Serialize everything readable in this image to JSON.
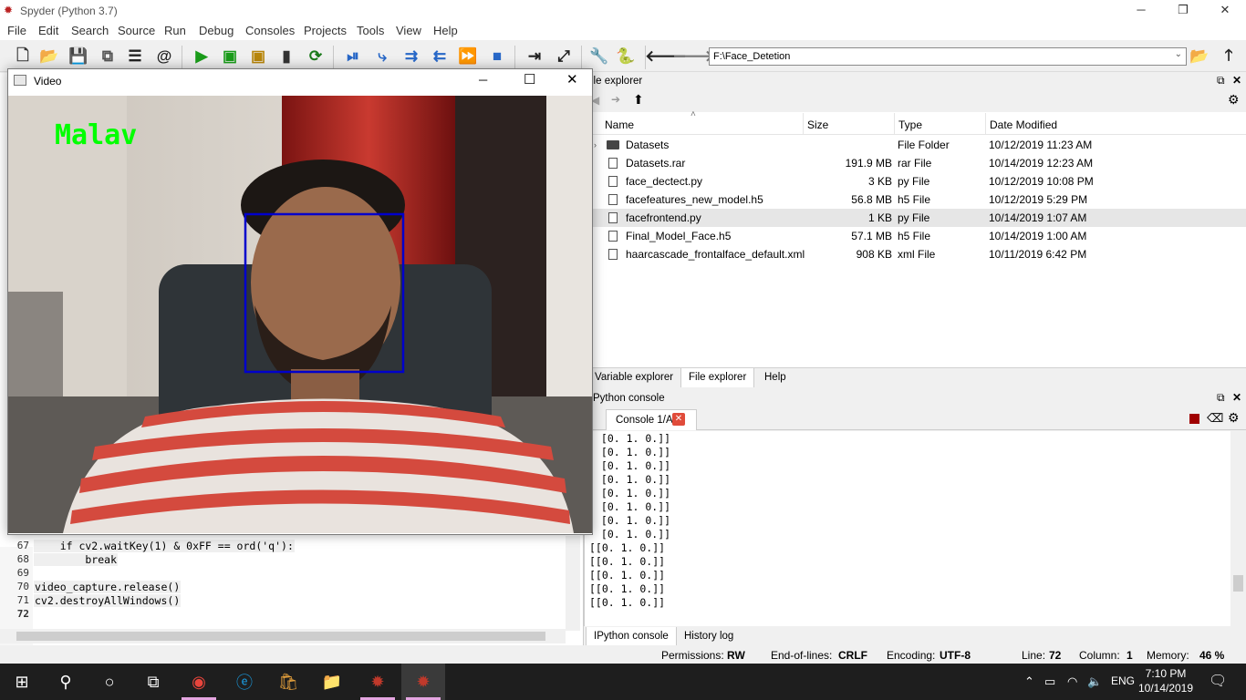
{
  "app": {
    "title": "Spyder (Python 3.7)",
    "minimize": "─",
    "maximize": "❐",
    "close": "✕"
  },
  "menu": [
    "File",
    "Edit",
    "Search",
    "Source",
    "Run",
    "Debug",
    "Consoles",
    "Projects",
    "Tools",
    "View",
    "Help"
  ],
  "toolbar": {
    "path": "F:\\Face_Detetion"
  },
  "editor": {
    "lines": [
      {
        "num": "67",
        "code": "    if cv2.waitKey(1) & 0xFF == ord('q'):"
      },
      {
        "num": "68",
        "code": "        break"
      },
      {
        "num": "69",
        "code": ""
      },
      {
        "num": "70",
        "code": "video_capture.release()"
      },
      {
        "num": "71",
        "code": "cv2.destroyAllWindows()"
      },
      {
        "num": "72",
        "code": ""
      }
    ]
  },
  "video": {
    "title": "Video",
    "minimize": "─",
    "maximize": "☐",
    "close": "✕",
    "label": "Malav"
  },
  "file_explorer": {
    "title": "ile explorer",
    "columns": {
      "name": "Name",
      "size": "Size",
      "type": "Type",
      "date": "Date Modified"
    },
    "rows": [
      {
        "name": "Datasets",
        "size": "",
        "type": "File Folder",
        "date": "10/12/2019 11:23 AM",
        "folder": true
      },
      {
        "name": "Datasets.rar",
        "size": "191.9 MB",
        "type": "rar File",
        "date": "10/14/2019 12:23 AM"
      },
      {
        "name": "face_dectect.py",
        "size": "3 KB",
        "type": "py File",
        "date": "10/12/2019 10:08 PM"
      },
      {
        "name": "facefeatures_new_model.h5",
        "size": "56.8 MB",
        "type": "h5 File",
        "date": "10/12/2019 5:29 PM"
      },
      {
        "name": "facefrontend.py",
        "size": "1 KB",
        "type": "py File",
        "date": "10/14/2019 1:07 AM"
      },
      {
        "name": "Final_Model_Face.h5",
        "size": "57.1 MB",
        "type": "h5 File",
        "date": "10/14/2019 1:00 AM"
      },
      {
        "name": "haarcascade_frontalface_default.xml",
        "size": "908 KB",
        "type": "xml File",
        "date": "10/11/2019 6:42 PM"
      }
    ]
  },
  "pane_tabs": {
    "variable": "Variable explorer",
    "file": "File explorer",
    "help": "Help"
  },
  "python_console": {
    "title": "Python console",
    "tab": "Console 1/A",
    "lines": [
      " [0. 1. 0.]]",
      " [0. 1. 0.]]",
      " [0. 1. 0.]]",
      " [0. 1. 0.]]",
      " [0. 1. 0.]]",
      " [0. 1. 0.]]",
      " [0. 1. 0.]]",
      " [0. 1. 0.]]",
      "[[0. 1. 0.]]",
      "[[0. 1. 0.]]",
      "[[0. 1. 0.]]",
      "[[0. 1. 0.]]",
      "[[0. 1. 0.]]"
    ]
  },
  "bottom_tabs": {
    "ipython": "IPython console",
    "history": "History log"
  },
  "status": {
    "perm_label": "Permissions:",
    "perm": "RW",
    "eol_label": "End-of-lines:",
    "eol": "CRLF",
    "enc_label": "Encoding:",
    "enc": "UTF-8",
    "line_label": "Line:",
    "line": "72",
    "col_label": "Column:",
    "col": "1",
    "mem_label": "Memory:",
    "mem": "46 %"
  },
  "taskbar": {
    "lang": "ENG",
    "time": "7:10 PM",
    "date": "10/14/2019"
  },
  "colors": {
    "accent": "#2a6f2a",
    "label_green": "#00ff00",
    "face_box": "#0000cc"
  }
}
